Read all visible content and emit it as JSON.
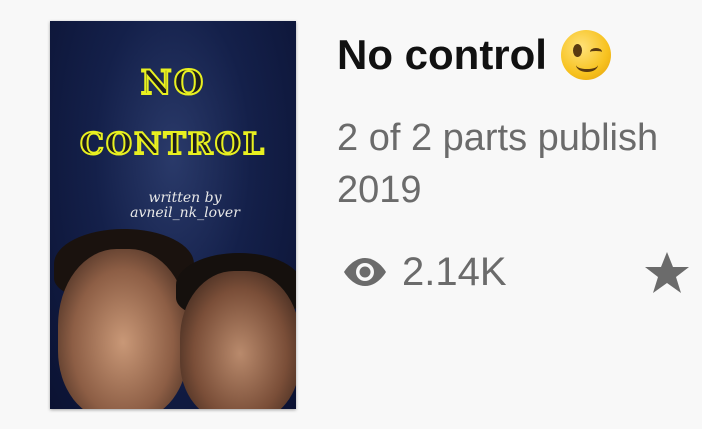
{
  "story": {
    "title": "No control",
    "title_emoji": "winking-face",
    "parts_line_1": "2 of 2 parts publish",
    "parts_line_2": "2019",
    "reads": "2.14K"
  },
  "cover": {
    "title_line_1": "NO",
    "title_line_2": "CONTROL",
    "author_line_1": "written by",
    "author_line_2": "avneil_nk_lover"
  },
  "icons": {
    "reads_icon": "eye-icon",
    "vote_icon": "star-icon",
    "icon_color": "#6b6b6b"
  }
}
